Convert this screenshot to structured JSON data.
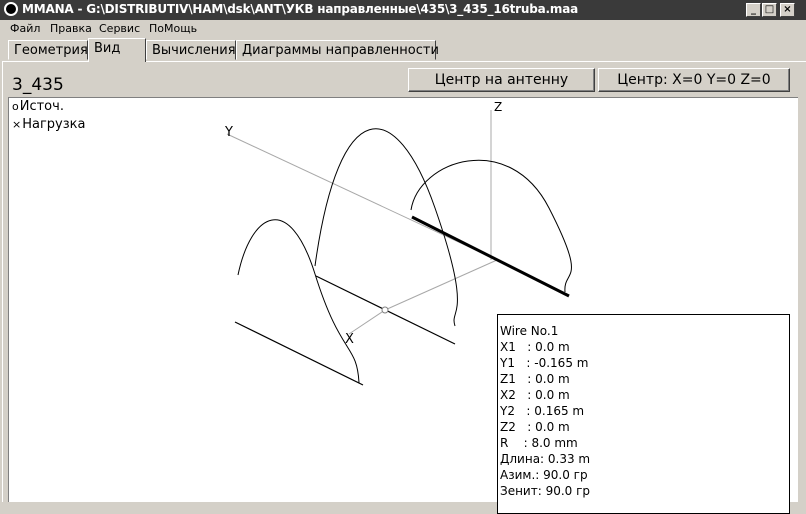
{
  "window": {
    "title": "MMANA - G:\\DISTRIBUTIV\\HAM\\dsk\\ANT\\УКВ направленные\\435\\3_435_16truba.maa",
    "minimize": "_",
    "restore": "□",
    "close": "×"
  },
  "menu": [
    "Файл",
    "Правка",
    "Сервис",
    "ПоМощь"
  ],
  "tabs": [
    "Геометрия",
    "Вид",
    "Вычисления",
    "Диаграммы направленности"
  ],
  "active_tab": "Вид",
  "project_name": "3_435",
  "buttons": {
    "center_on_antenna": "Центр на антенну",
    "center_coords": "Центр: X=0 Y=0 Z=0"
  },
  "legend": {
    "source_symbol": "o",
    "source": "Источ.",
    "load_symbol": "×",
    "load": "Нагрузка"
  },
  "axes": {
    "x": "X",
    "y": "Y",
    "z": "Z"
  },
  "wire_info": {
    "title": "Wire No.1",
    "rows": [
      "X1   : 0.0 m",
      "Y1   : -0.165 m",
      "Z1   : 0.0 m",
      "X2   : 0.0 m",
      "Y2   : 0.165 m",
      "Z2   : 0.0 m",
      "R    : 8.0 mm",
      "Длина: 0.33 m",
      "Азим.: 90.0 гр",
      "Зенит: 90.0 гр"
    ]
  },
  "colors": {
    "titlebar": "#3a3a3a",
    "window_bg": "#d4d0c8",
    "view_bg": "#ffffff",
    "axis": "#a0a0a0",
    "wire": "#000000"
  }
}
